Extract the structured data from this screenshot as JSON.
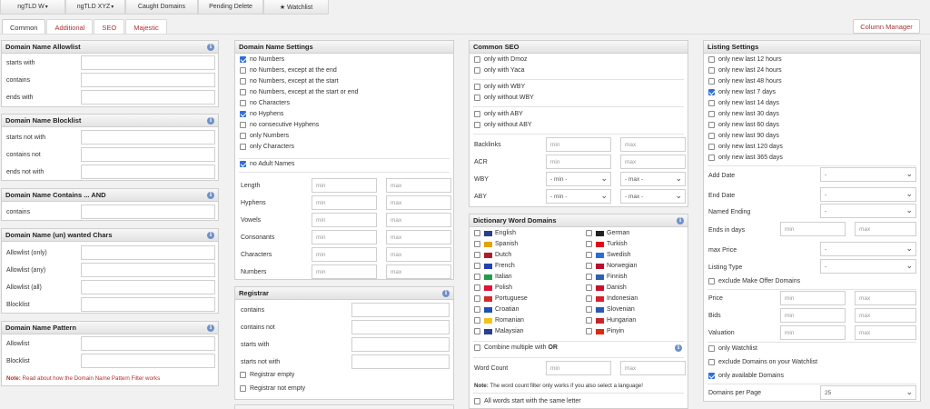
{
  "topbar": [
    "ngTLD W",
    "ngTLD XYZ",
    "Caught Domains",
    "Pending Delete",
    "★ Watchlist"
  ],
  "tabs": [
    "Common",
    "Additional",
    "SEO",
    "Majestic"
  ],
  "column_manager": "Column Manager",
  "info_glyph": "i",
  "placeholders": {
    "min": "min",
    "max": "max",
    "select_min": "- min -",
    "select_max": "- max -",
    "dash": "-",
    "page": "25"
  },
  "col1": {
    "allowlist": {
      "title": "Domain Name Allowlist",
      "fields": [
        "starts with",
        "contains",
        "ends with"
      ]
    },
    "blocklist": {
      "title": "Domain Name Blocklist",
      "fields": [
        "starts not with",
        "contains not",
        "ends not with"
      ]
    },
    "contains_and": {
      "title": "Domain Name Contains ... AND",
      "fields": [
        "contains"
      ]
    },
    "wanted_chars": {
      "title": "Domain Name (un) wanted Chars",
      "fields": [
        "Allowlist (only)",
        "Allowlist (any)",
        "Allowlist (all)",
        "Blocklist"
      ]
    },
    "pattern": {
      "title": "Domain Name Pattern",
      "fields": [
        "Allowlist",
        "Blocklist"
      ],
      "note_prefix": "Note:",
      "note_link": "Read about how the Domain Name Pattern Filter works"
    }
  },
  "col2": {
    "settings": {
      "title": "Domain Name Settings",
      "checks": [
        {
          "label": "no Numbers",
          "checked": true
        },
        {
          "label": "no Numbers, except at the end",
          "checked": false
        },
        {
          "label": "no Numbers, except at the start",
          "checked": false
        },
        {
          "label": "no Numbers, except at the start or end",
          "checked": false
        },
        {
          "label": "no Characters",
          "checked": false
        },
        {
          "label": "no Hyphens",
          "checked": true
        },
        {
          "label": "no consecutive Hyphens",
          "checked": false
        },
        {
          "label": "only Numbers",
          "checked": false
        },
        {
          "label": "only Characters",
          "checked": false
        }
      ],
      "adult": {
        "label": "no Adult Names",
        "checked": true
      },
      "ranges": [
        "Length",
        "Hyphens",
        "Vowels",
        "Consonants",
        "Characters",
        "Numbers"
      ]
    },
    "registrar": {
      "title": "Registrar",
      "fields": [
        "contains",
        "contains not",
        "starts with",
        "starts not with"
      ],
      "checks": [
        {
          "label": "Registrar empty",
          "checked": false
        },
        {
          "label": "Registrar not empty",
          "checked": false
        }
      ]
    }
  },
  "col3": {
    "seo": {
      "title": "Common SEO",
      "group1": [
        {
          "label": "only with Dmoz",
          "checked": false
        },
        {
          "label": "only with Yaca",
          "checked": false
        }
      ],
      "group2": [
        {
          "label": "only with WBY",
          "checked": false
        },
        {
          "label": "only without WBY",
          "checked": false
        }
      ],
      "group3": [
        {
          "label": "only with ABY",
          "checked": false
        },
        {
          "label": "only without ABY",
          "checked": false
        }
      ],
      "ranges": [
        "Backlinks",
        "ACR"
      ],
      "selects": [
        "WBY",
        "ABY"
      ]
    },
    "dict": {
      "title": "Dictionary Word Domains",
      "left": [
        {
          "label": "English",
          "flag": "#27408b"
        },
        {
          "label": "Spanish",
          "flag": "#e2a400"
        },
        {
          "label": "Dutch",
          "flag": "#ae1c28"
        },
        {
          "label": "French",
          "flag": "#2244aa"
        },
        {
          "label": "Italian",
          "flag": "#1e9e4a"
        },
        {
          "label": "Polish",
          "flag": "#dc143c"
        },
        {
          "label": "Portuguese",
          "flag": "#d12a2a"
        },
        {
          "label": "Croatian",
          "flag": "#1f4fb0"
        },
        {
          "label": "Romanian",
          "flag": "#f0c419"
        },
        {
          "label": "Malaysian",
          "flag": "#2a3f8f"
        }
      ],
      "right": [
        {
          "label": "German",
          "flag": "#222222"
        },
        {
          "label": "Turkish",
          "flag": "#e30a17"
        },
        {
          "label": "Swedish",
          "flag": "#2a6fd0"
        },
        {
          "label": "Norwegian",
          "flag": "#ba0c2f"
        },
        {
          "label": "Finnish",
          "flag": "#2d5fb3"
        },
        {
          "label": "Danish",
          "flag": "#c8102e"
        },
        {
          "label": "Indonesian",
          "flag": "#d81e2a"
        },
        {
          "label": "Slovenian",
          "flag": "#2a58b5"
        },
        {
          "label": "Hungarian",
          "flag": "#c1272d"
        },
        {
          "label": "Pinyin",
          "flag": "#de2910"
        }
      ],
      "combine_label": "Combine multiple with",
      "combine_or": "OR",
      "word_count": "Word Count",
      "note_prefix": "Note:",
      "note_text": "The word count filter only works if you also select a language!",
      "same_letter": "All words start with the same letter"
    }
  },
  "col4": {
    "title": "Listing Settings",
    "checks": [
      {
        "label": "only new last 12 hours",
        "checked": false
      },
      {
        "label": "only new last 24 hours",
        "checked": false
      },
      {
        "label": "only new last 48 hours",
        "checked": false
      },
      {
        "label": "only new last 7 days",
        "checked": true
      },
      {
        "label": "only new last 14 days",
        "checked": false
      },
      {
        "label": "only new last 30 days",
        "checked": false
      },
      {
        "label": "only new last 60 days",
        "checked": false
      },
      {
        "label": "only new last 90 days",
        "checked": false
      },
      {
        "label": "only new last 120 days",
        "checked": false
      },
      {
        "label": "only new last 365 days",
        "checked": false
      }
    ],
    "add_date": "Add Date",
    "end_date": "End Date",
    "named_ending": "Named Ending",
    "ends_in_days": "Ends in days",
    "max_price": "max Price",
    "listing_type": "Listing Type",
    "make_offer": {
      "label": "exclude Make Offer Domains",
      "checked": false
    },
    "price": "Price",
    "bids": "Bids",
    "valuation": "Valuation",
    "only_watchlist": {
      "label": "only Watchlist",
      "checked": false
    },
    "excl_watchlist": {
      "label": "exclude Domains on your Watchlist",
      "checked": false
    },
    "only_available": {
      "label": "only available Domains",
      "checked": true
    },
    "per_page": "Domains per Page"
  }
}
